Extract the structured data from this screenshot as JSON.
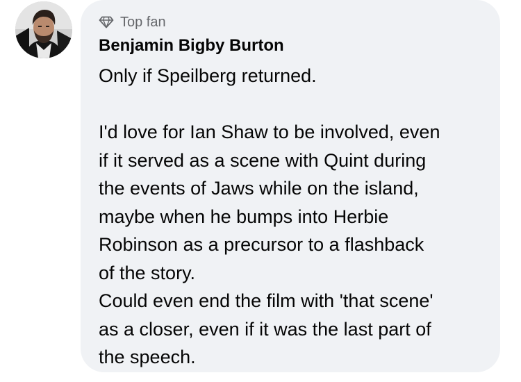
{
  "commenter": {
    "avatar_icon": "user-avatar-photo",
    "badge_icon": "diamond-icon",
    "badge": "Top fan",
    "name": "Benjamin Bigby Burton"
  },
  "comment": {
    "lines": [
      "Only if Speilberg returned.",
      "",
      "I'd love for Ian Shaw to be involved, even",
      "if it served as a scene with Quint during",
      "the events of Jaws while on the island,",
      "maybe when he bumps into Herbie",
      "Robinson as a precursor to a flashback",
      "of the story.",
      "Could even end the film with 'that scene'",
      "as a closer, even if it was the last part of",
      "the speech."
    ]
  },
  "colors": {
    "bubble_background": "#f0f2f5",
    "badge_text": "#65676b",
    "primary_text": "#050505"
  }
}
